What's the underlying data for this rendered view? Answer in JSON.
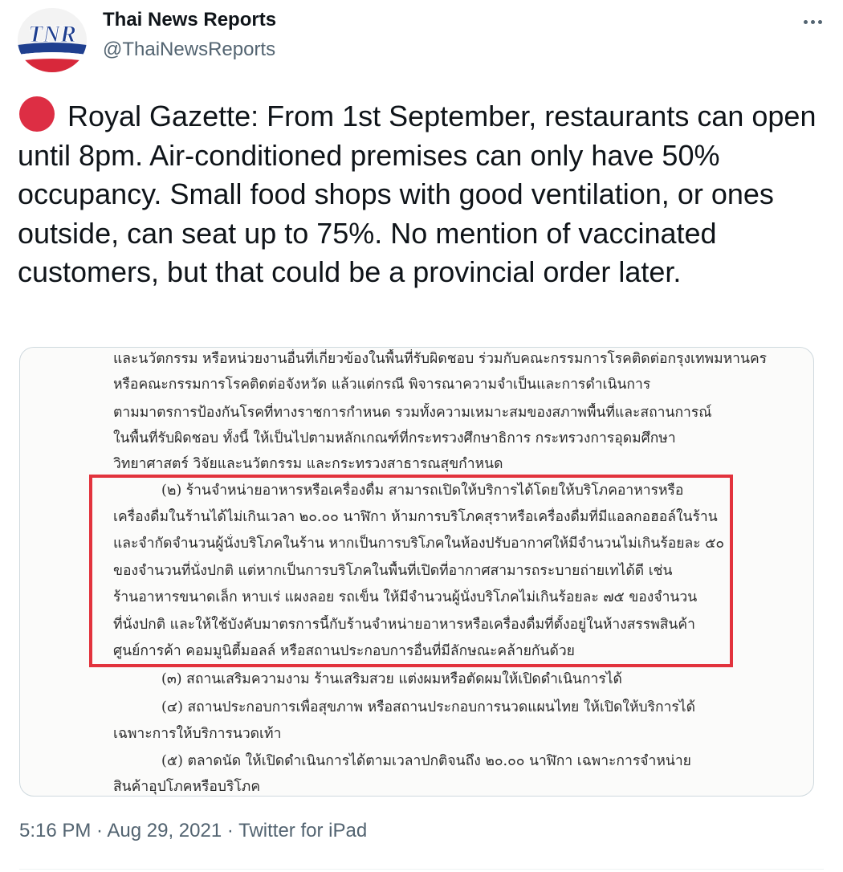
{
  "author": {
    "avatar_text": "TNR",
    "name": "Thai News Reports",
    "handle": "@ThaiNewsReports"
  },
  "tweet": {
    "emoji_icon": "red-circle-icon",
    "text": "Royal Gazette: From 1st September, restaurants can open until 8pm. Air-conditioned premises can only have 50% occupancy. Small food shops with good ventilation, or ones outside, can seat up to 75%. No mention of vaccinated customers, but that could be a provincial order later."
  },
  "document": {
    "lines": [
      "และนวัตกรรม หรือหน่วยงานอื่นที่เกี่ยวข้องในพื้นที่รับผิดชอบ ร่วมกับคณะกรรมการโรคติดต่อกรุงเทพมหานคร",
      "หรือคณะกรรมการโรคติดต่อจังหวัด แล้วแต่กรณี พิจารณาความจำเป็นและการดำเนินการ",
      "ตามมาตรการป้องกันโรคที่ทางราชการกำหนด รวมทั้งความเหมาะสมของสภาพพื้นที่และสถานการณ์",
      "ในพื้นที่รับผิดชอบ ทั้งนี้ ให้เป็นไปตามหลักเกณฑ์ที่กระทรวงศึกษาธิการ กระทรวงการอุดมศึกษา",
      "วิทยาศาสตร์ วิจัยและนวัตกรรม และกระทรวงสาธารณสุขกำหนด",
      "(๒) ร้านจำหน่ายอาหารหรือเครื่องดื่ม สามารถเปิดให้บริการได้โดยให้บริโภคอาหารหรือ",
      "เครื่องดื่มในร้านได้ไม่เกินเวลา ๒๐.๐๐ นาฬิกา ห้ามการบริโภคสุราหรือเครื่องดื่มที่มีแอลกอฮอล์ในร้าน",
      "และจำกัดจำนวนผู้นั่งบริโภคในร้าน หากเป็นการบริโภคในห้องปรับอากาศให้มีจำนวนไม่เกินร้อยละ ๕๐",
      "ของจำนวนที่นั่งปกติ แต่หากเป็นการบริโภคในพื้นที่เปิดที่อากาศสามารถระบายถ่ายเทได้ดี เช่น",
      "ร้านอาหารขนาดเล็ก หาบเร่ แผงลอย รถเข็น ให้มีจำนวนผู้นั่งบริโภคไม่เกินร้อยละ ๗๕ ของจำนวน",
      "ที่นั่งปกติ และให้ใช้บังคับมาตรการนี้กับร้านจำหน่ายอาหารหรือเครื่องดื่มที่ตั้งอยู่ในห้างสรรพสินค้า",
      "ศูนย์การค้า คอมมูนิตี้มอลล์ หรือสถานประกอบการอื่นที่มีลักษณะคล้ายกันด้วย",
      "(๓) สถานเสริมความงาม ร้านเสริมสวย แต่งผมหรือตัดผมให้เปิดดำเนินการได้",
      "(๔) สถานประกอบการเพื่อสุขภาพ หรือสถานประกอบการนวดแผนไทย ให้เปิดให้บริการได้",
      "เฉพาะการให้บริการนวดเท้า",
      "(๕) ตลาดนัด ให้เปิดดำเนินการได้ตามเวลาปกติจนถึง ๒๐.๐๐ นาฬิกา เฉพาะการจำหน่าย",
      "สินค้าอุปโภคหรือบริโภค"
    ],
    "highlight_color": "#e2333d"
  },
  "meta": {
    "time": "5:16 PM",
    "separator": " · ",
    "date": "Aug 29, 2021",
    "source": "Twitter for iPad"
  }
}
